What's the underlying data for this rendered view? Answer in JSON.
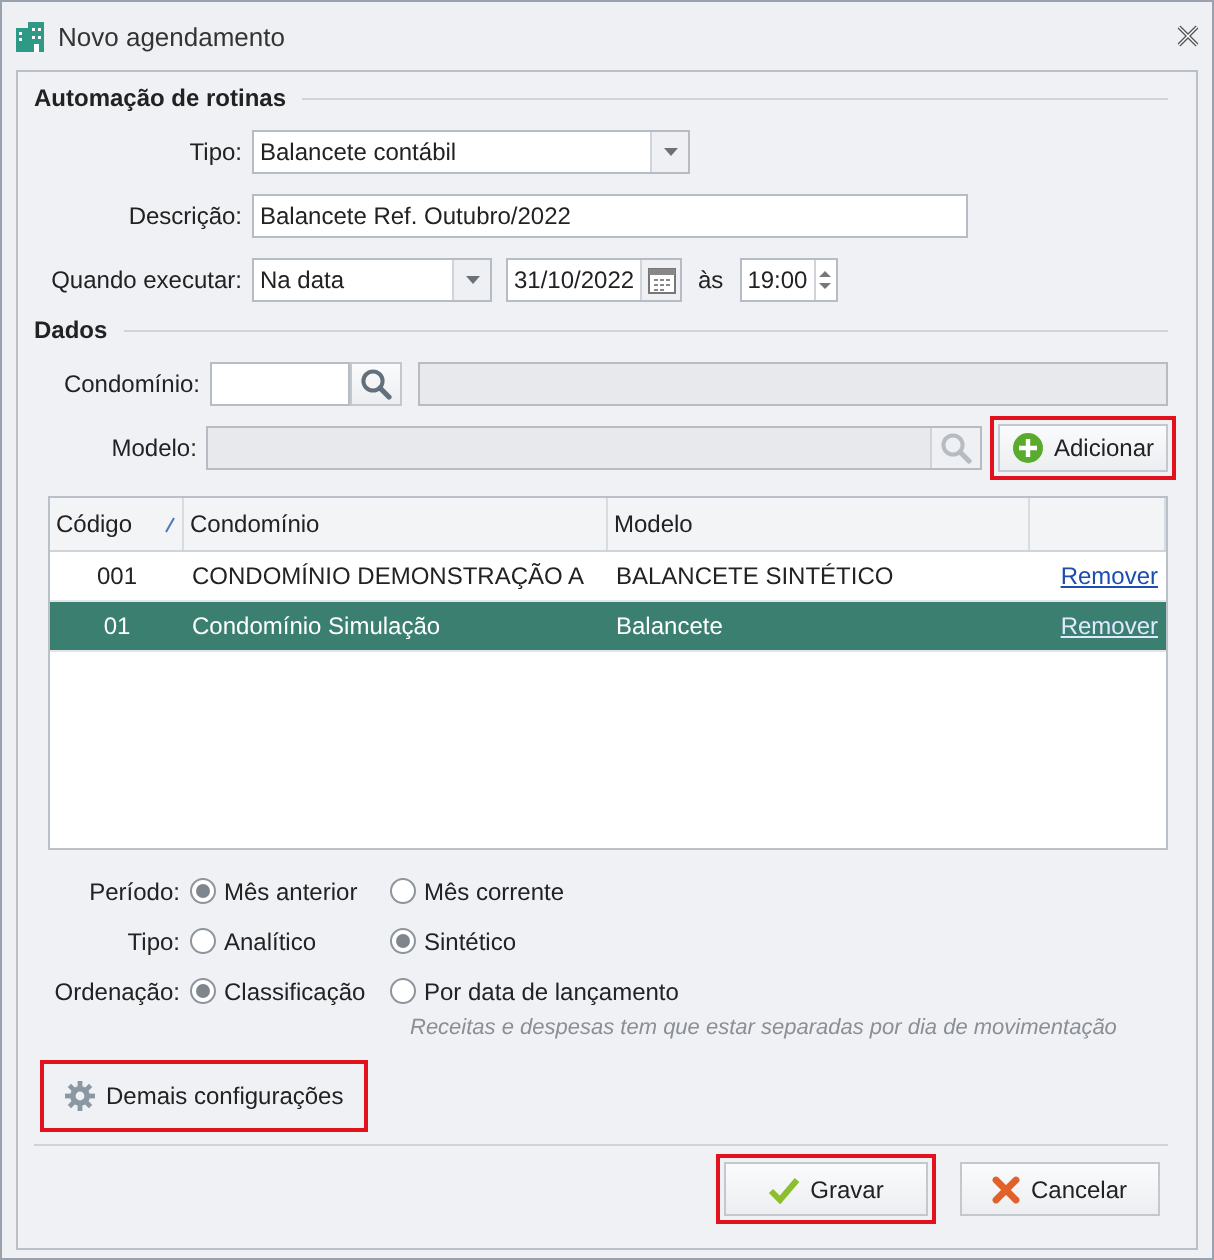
{
  "window": {
    "title": "Novo agendamento"
  },
  "automacao": {
    "title": "Automação de rotinas",
    "tipo": {
      "label": "Tipo:",
      "value": "Balancete contábil"
    },
    "descricao": {
      "label": "Descrição:",
      "value": "Balancete Ref. Outubro/2022"
    },
    "quando": {
      "label": "Quando executar:",
      "value": "Na data",
      "date": "31/10/2022",
      "at_label": "às",
      "time": "19:00"
    }
  },
  "dados": {
    "title": "Dados",
    "condominio": {
      "label": "Condomínio:",
      "name_disabled": true
    },
    "modelo": {
      "label": "Modelo:",
      "disabled": true
    },
    "add_button": {
      "label": "Adicionar",
      "highlighted": true
    }
  },
  "table": {
    "columns": [
      "Código",
      "Condomínio",
      "Modelo"
    ],
    "rows": [
      {
        "cells": [
          "001",
          "CONDOMÍNIO DEMONSTRAÇÃO A",
          "BALANCETE SINTÉTICO"
        ],
        "action": "Remover",
        "selected": false
      },
      {
        "cells": [
          "01",
          "Condomínio Simulação",
          "Balancete"
        ],
        "action": "Remover",
        "selected": true
      }
    ]
  },
  "options": [
    {
      "label": "Período:",
      "choices": [
        {
          "label": "Mês anterior",
          "selected": true
        },
        {
          "label": "Mês corrente",
          "selected": false
        }
      ]
    },
    {
      "label": "Tipo:",
      "choices": [
        {
          "label": "Analítico",
          "selected": false
        },
        {
          "label": "Sintético",
          "selected": true
        }
      ]
    },
    {
      "label": "Ordenação:",
      "choices": [
        {
          "label": "Classificação",
          "selected": true
        },
        {
          "label": "Por data de lançamento",
          "selected": false
        }
      ]
    }
  ],
  "hint": "Receitas e despesas tem que estar separadas por dia de movimentação",
  "settings_button": {
    "label": "Demais configurações",
    "highlighted": true
  },
  "buttons": [
    {
      "kind": "save",
      "label": "Gravar",
      "highlighted": true
    },
    {
      "kind": "cancel",
      "label": "Cancelar",
      "highlighted": false
    }
  ]
}
